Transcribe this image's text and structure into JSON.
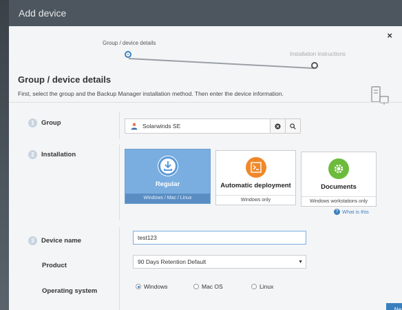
{
  "dialog": {
    "title": "Add device",
    "close_label": "×"
  },
  "wizard": {
    "steps": [
      {
        "label": "Group / device details",
        "active": true
      },
      {
        "label": "Installation instructions",
        "active": false
      }
    ]
  },
  "section": {
    "title": "Group / device details",
    "description": "First, select the group and the Backup Manager installation method. Then enter the device information."
  },
  "group": {
    "number": "1",
    "label": "Group",
    "value": "Solarwinds SE",
    "clear_icon": "clear-circle-icon",
    "search_icon": "search-icon"
  },
  "installation": {
    "number": "2",
    "label": "Installation",
    "options": [
      {
        "title": "Regular",
        "subtitle": "Windows / Mac / Linux",
        "icon": "download-icon",
        "color": "#5a9ad8",
        "selected": true
      },
      {
        "title": "Automatic deployment",
        "subtitle": "Windows only",
        "icon": "terminal-icon",
        "color": "#f0882a",
        "selected": false
      },
      {
        "title": "Documents",
        "subtitle": "Windows workstations only",
        "icon": "gear-icon",
        "color": "#6cbb3c",
        "selected": false
      }
    ],
    "help_link": "What is this"
  },
  "device": {
    "number": "3",
    "label": "Device name",
    "value": "test123"
  },
  "product": {
    "label": "Product",
    "selected": "90 Days Retention Default"
  },
  "os": {
    "label": "Operating system",
    "options": [
      {
        "label": "Windows",
        "checked": true
      },
      {
        "label": "Mac OS",
        "checked": false
      },
      {
        "label": "Linux",
        "checked": false
      }
    ]
  },
  "footer": {
    "next_label": "Next"
  }
}
